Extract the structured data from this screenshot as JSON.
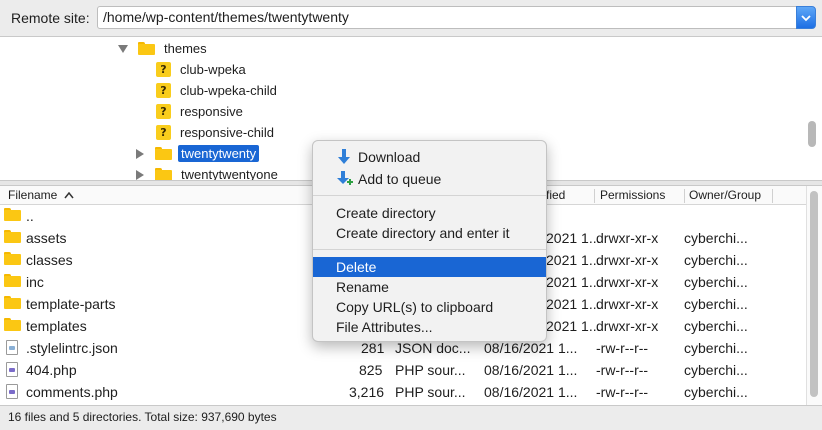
{
  "remote_site": {
    "label": "Remote site:",
    "path": "/home/wp-content/themes/twentytwenty"
  },
  "tree": [
    {
      "name": "themes",
      "icon": "folder-icon",
      "arrow": "expanded"
    },
    {
      "name": "club-wpeka",
      "icon": "unknown-folder-icon"
    },
    {
      "name": "club-wpeka-child",
      "icon": "unknown-folder-icon"
    },
    {
      "name": "responsive",
      "icon": "unknown-folder-icon"
    },
    {
      "name": "responsive-child",
      "icon": "unknown-folder-icon"
    },
    {
      "name": "twentytwenty",
      "icon": "folder-icon",
      "arrow": "collapsed",
      "selected": true
    },
    {
      "name": "twentytwentyone",
      "icon": "folder-icon",
      "arrow": "collapsed"
    }
  ],
  "file_list": {
    "columns": {
      "filename": "Filename",
      "modified_visible": "fied",
      "permissions": "Permissions",
      "owner": "Owner/Group"
    },
    "rows": [
      {
        "name": "..",
        "size": "",
        "type": "",
        "modified": "",
        "perm": "",
        "owner": "",
        "icon": "folder-icon"
      },
      {
        "name": "assets",
        "size": "",
        "type": "",
        "modified": "2021 1...",
        "perm": "drwxr-xr-x",
        "owner": "cyberchi...",
        "icon": "folder-icon"
      },
      {
        "name": "classes",
        "size": "",
        "type": "",
        "modified": "2021 1...",
        "perm": "drwxr-xr-x",
        "owner": "cyberchi...",
        "icon": "folder-icon"
      },
      {
        "name": "inc",
        "size": "",
        "type": "",
        "modified": "2021 1...",
        "perm": "drwxr-xr-x",
        "owner": "cyberchi...",
        "icon": "folder-icon"
      },
      {
        "name": "template-parts",
        "size": "",
        "type": "",
        "modified": "2021 1...",
        "perm": "drwxr-xr-x",
        "owner": "cyberchi...",
        "icon": "folder-icon"
      },
      {
        "name": "templates",
        "size": "",
        "type": "",
        "modified": "2021 1...",
        "perm": "drwxr-xr-x",
        "owner": "cyberchi...",
        "icon": "folder-icon"
      },
      {
        "name": ".stylelintrc.json",
        "size": "281",
        "type": "JSON doc...",
        "modified": "08/16/2021 1...",
        "perm": "-rw-r--r--",
        "owner": "cyberchi...",
        "icon": "json-file-icon"
      },
      {
        "name": "404.php",
        "size": "825",
        "type": "PHP sour...",
        "modified": "08/16/2021 1...",
        "perm": "-rw-r--r--",
        "owner": "cyberchi...",
        "icon": "php-file-icon"
      },
      {
        "name": "comments.php",
        "size": "3,216",
        "type": "PHP sour...",
        "modified": "08/16/2021 1...",
        "perm": "-rw-r--r--",
        "owner": "cyberchi...",
        "icon": "php-file-icon"
      }
    ]
  },
  "context_menu": {
    "download": "Download",
    "add_to_queue": "Add to queue",
    "create_directory": "Create directory",
    "create_directory_enter": "Create directory and enter it",
    "delete": "Delete",
    "rename": "Rename",
    "copy_url": "Copy URL(s) to clipboard",
    "file_attributes": "File Attributes..."
  },
  "status": {
    "summary": "16 files and 5 directories. Total size: 937,690 bytes"
  },
  "colors": {
    "selection": "#1966d4",
    "folder": "#fbc713"
  }
}
